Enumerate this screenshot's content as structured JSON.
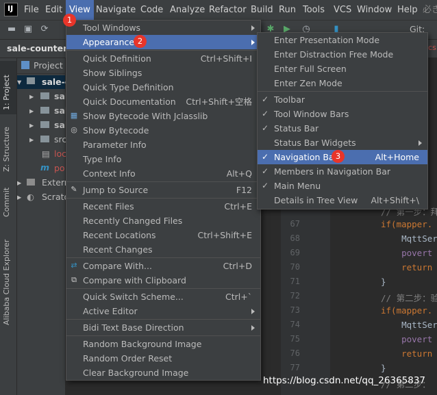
{
  "menubar": {
    "items": [
      "File",
      "Edit",
      "View",
      "Navigate",
      "Code",
      "Analyze",
      "Refactor",
      "Build",
      "Run",
      "Tools",
      "VCS",
      "Window",
      "Help",
      "必き"
    ]
  },
  "toolbar": {
    "vcs_label": "Git:"
  },
  "project": {
    "tab_title": "sale-counter-p",
    "header": "Project",
    "tree": [
      "sale-c",
      "sal",
      "sal",
      "sal",
      "src",
      "loc",
      "po",
      "Extern",
      "Scrato"
    ]
  },
  "tool_stripe": [
    "1: Project",
    "Z: Structure",
    "Commit",
    "Alibaba Cloud Explorer"
  ],
  "badges": [
    "1",
    "2",
    "3"
  ],
  "view_menu": {
    "items": [
      {
        "label": "Tool Windows",
        "shortcut": "",
        "submenu": true
      },
      {
        "label": "Appearance",
        "shortcut": "",
        "submenu": true,
        "selected": true
      },
      {
        "label": "Quick Definition",
        "shortcut": "Ctrl+Shift+I"
      },
      {
        "label": "Show Siblings",
        "shortcut": ""
      },
      {
        "label": "Quick Type Definition",
        "shortcut": ""
      },
      {
        "label": "Quick Documentation",
        "shortcut": "Ctrl+Shift+空格"
      },
      {
        "label": "Show Bytecode With Jclasslib",
        "shortcut": ""
      },
      {
        "label": "Show Bytecode",
        "shortcut": ""
      },
      {
        "label": "Parameter Info",
        "shortcut": ""
      },
      {
        "label": "Type Info",
        "shortcut": ""
      },
      {
        "label": "Context Info",
        "shortcut": "Alt+Q"
      },
      {
        "label": "Jump to Source",
        "shortcut": "F12"
      },
      {
        "label": "Recent Files",
        "shortcut": "Ctrl+E"
      },
      {
        "label": "Recently Changed Files",
        "shortcut": ""
      },
      {
        "label": "Recent Locations",
        "shortcut": "Ctrl+Shift+E"
      },
      {
        "label": "Recent Changes",
        "shortcut": ""
      },
      {
        "label": "Compare With...",
        "shortcut": "Ctrl+D"
      },
      {
        "label": "Compare with Clipboard",
        "shortcut": ""
      },
      {
        "label": "Quick Switch Scheme...",
        "shortcut": "Ctrl+`"
      },
      {
        "label": "Active Editor",
        "shortcut": "",
        "submenu": true
      },
      {
        "label": "Bidi Text Base Direction",
        "shortcut": "",
        "submenu": true
      },
      {
        "label": "Random Background Image",
        "shortcut": ""
      },
      {
        "label": "Random Order Reset",
        "shortcut": ""
      },
      {
        "label": "Clear Background Image",
        "shortcut": ""
      }
    ]
  },
  "appearance_menu": {
    "items": [
      {
        "label": "Enter Presentation Mode",
        "shortcut": "",
        "checked": false
      },
      {
        "label": "Enter Distraction Free Mode",
        "shortcut": "",
        "checked": false
      },
      {
        "label": "Enter Full Screen",
        "shortcut": "",
        "checked": false
      },
      {
        "label": "Enter Zen Mode",
        "shortcut": "",
        "checked": false
      },
      {
        "label": "Toolbar",
        "shortcut": "",
        "checked": true
      },
      {
        "label": "Tool Window Bars",
        "shortcut": "",
        "checked": true
      },
      {
        "label": "Status Bar",
        "shortcut": "",
        "checked": true
      },
      {
        "label": "Status Bar Widgets",
        "shortcut": "",
        "checked": false,
        "submenu": true
      },
      {
        "label": "Navigation Bar",
        "shortcut": "Alt+Home",
        "checked": true,
        "selected": true
      },
      {
        "label": "Members in Navigation Bar",
        "shortcut": "",
        "checked": true
      },
      {
        "label": "Main Menu",
        "shortcut": "",
        "checked": true
      },
      {
        "label": "Details in Tree View",
        "shortcut": "Alt+Shift+\\",
        "checked": false
      }
    ]
  },
  "editor": {
    "line_numbers": [
      "67",
      "68",
      "69",
      "70",
      "71",
      "72",
      "73",
      "74",
      "75",
      "76",
      "77"
    ],
    "lines": [
      {
        "kind": "comment",
        "text": "// 第一步：拜"
      },
      {
        "kind": "kw",
        "text": "if(mapper."
      },
      {
        "kind": "id",
        "text": "    MqttSer"
      },
      {
        "kind": "pv",
        "text": "    povert"
      },
      {
        "kind": "kw",
        "text": "    return"
      },
      {
        "kind": "id",
        "text": "}"
      },
      {
        "kind": "comment",
        "text": "// 第二步：验"
      },
      {
        "kind": "kw",
        "text": "if(mapper."
      },
      {
        "kind": "id",
        "text": "    MqttSer"
      },
      {
        "kind": "pv",
        "text": "    povert"
      },
      {
        "kind": "kw",
        "text": "    return"
      },
      {
        "kind": "id",
        "text": "}"
      },
      {
        "kind": "comment",
        "text": "// 第二步："
      }
    ]
  },
  "watermark": "https://blog.csdn.net/qq_26365837",
  "colors": {
    "accent": "#4b6eaf",
    "badge": "#e8352a",
    "menu_bg": "#3c3f41",
    "editor_bg": "#2b2b2b"
  }
}
